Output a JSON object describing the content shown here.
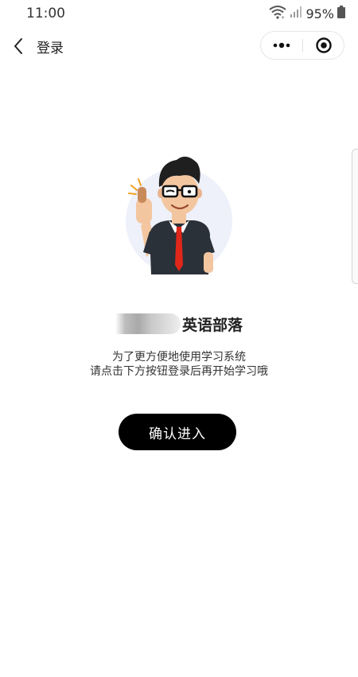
{
  "status_bar": {
    "time": "11:00",
    "battery": "95%"
  },
  "nav": {
    "title": "登录"
  },
  "brand": {
    "name": "英语部落"
  },
  "description": {
    "line1": "为了更方便地使用学习系统",
    "line2": "请点击下方按钮登录后再开始学习哦"
  },
  "actions": {
    "confirm_label": "确认进入"
  },
  "colors": {
    "button_bg": "#000000",
    "tie": "#e0271a",
    "shirt": "#2b3138",
    "illustration_bg": "#eef0fa"
  },
  "icons": {
    "back": "chevron-left-icon",
    "more": "more-dots-icon",
    "close": "target-circle-icon",
    "wifi": "wifi-icon",
    "signal": "signal-icon",
    "battery": "battery-icon"
  }
}
